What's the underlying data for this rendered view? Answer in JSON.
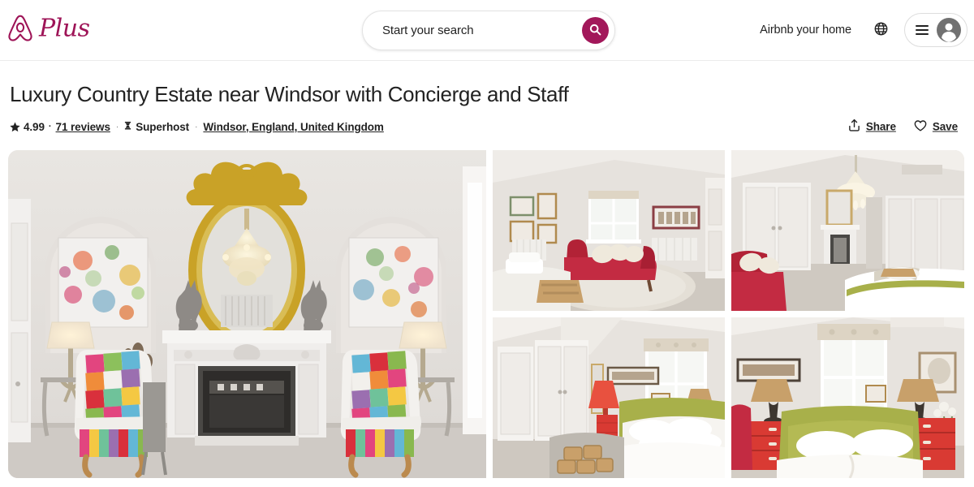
{
  "header": {
    "brand": {
      "name": "Airbnb Plus",
      "word": "Plus",
      "logo_icon": "airbnb-bel-logo",
      "color": "#9e1457"
    },
    "search": {
      "placeholder": "Start your search",
      "value": "",
      "button_icon": "search-icon",
      "button_color": "#a2185a"
    },
    "host_link": "Airbnb your home",
    "globe_icon": "globe-icon",
    "menu_icon": "hamburger-icon",
    "avatar_icon": "user-avatar-icon"
  },
  "listing": {
    "title": "Luxury Country Estate near Windsor with Concierge and Staff",
    "rating": "4.99",
    "rating_icon": "star-icon",
    "reviews": "71 reviews",
    "separator": "·",
    "superhost_icon": "superhost-badge-icon",
    "superhost": "Superhost",
    "location": "Windsor, England, United Kingdom",
    "actions": {
      "share": {
        "label": "Share",
        "icon": "share-upload-icon"
      },
      "save": {
        "label": "Save",
        "icon": "heart-icon"
      }
    }
  },
  "gallery": {
    "photos": [
      {
        "name": "photo-drawing-room",
        "alt": "Drawing room with marble fireplace, gilt oval mirror, crystal chandelier and two patchwork wing chairs"
      },
      {
        "name": "photo-bedroom-chaise",
        "alt": "Bedroom with red velvet chaise longue, framed pictures and sash window"
      },
      {
        "name": "photo-bedroom-chandelier",
        "alt": "Bedroom with chandelier, fitted white wardrobes, fireplace and red chaise"
      },
      {
        "name": "photo-bedroom-wardrobe",
        "alt": "Bedroom with olive green bed, white wardrobes, red lamp and log basket"
      },
      {
        "name": "photo-bedroom-green-bed",
        "alt": "Bedroom with olive green headboard, red lacquer nightstands and tall window"
      }
    ]
  }
}
